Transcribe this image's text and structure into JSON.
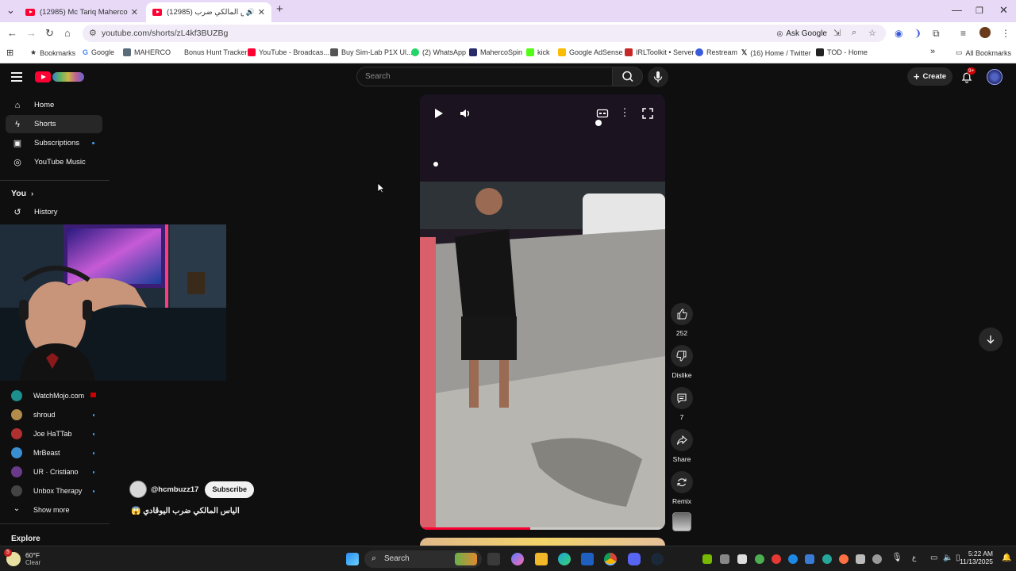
{
  "browser": {
    "tabs": [
      {
        "title": "(12985) Mc Tariq Maherco Drin…",
        "active": false
      },
      {
        "title": "(12985) الياس المالكي ضرب",
        "active": true
      }
    ],
    "new_tab": "+",
    "url": "youtube.com/shorts/zL4kf3BUZBg",
    "ask_google": "Ask Google",
    "bookmarks": [
      {
        "label": "Bookmarks",
        "color": "#333333"
      },
      {
        "label": "Google",
        "color": "#4285f4"
      },
      {
        "label": "MAHERCO",
        "color": "#5b6b7a"
      },
      {
        "label": "Bonus Hunt Tracker",
        "color": "#ffffff"
      },
      {
        "label": "YouTube - Broadcas...",
        "color": "#ff0033"
      },
      {
        "label": "Buy Sim-Lab P1X Ul...",
        "color": "#555555"
      },
      {
        "label": "(2) WhatsApp",
        "color": "#25d366"
      },
      {
        "label": "MahercoSpin",
        "color": "#2a2a6a"
      },
      {
        "label": "kick",
        "color": "#53fc18"
      },
      {
        "label": "Google AdSense",
        "color": "#fbbc04"
      },
      {
        "label": "IRLToolkit • Server",
        "color": "#c62828"
      },
      {
        "label": "Restream",
        "color": "#3a5bd9"
      },
      {
        "label": "(16) Home / Twitter",
        "color": "#111111"
      },
      {
        "label": "TOD - Home",
        "color": "#222222"
      }
    ],
    "all_bookmarks": "All Bookmarks"
  },
  "youtube": {
    "search_placeholder": "Search",
    "create_label": "Create",
    "notif_badge": "9+",
    "sidebar": {
      "main": [
        {
          "label": "Home",
          "icon": "home-icon",
          "active": false
        },
        {
          "label": "Shorts",
          "icon": "shorts-icon",
          "active": true
        },
        {
          "label": "Subscriptions",
          "icon": "subscriptions-icon",
          "active": false
        },
        {
          "label": "YouTube Music",
          "icon": "music-icon",
          "active": false
        }
      ],
      "you_label": "You",
      "history_label": "History",
      "subscriptions": [
        {
          "label": "WatchMojo.com",
          "color": "#1c8f8f"
        },
        {
          "label": "shroud",
          "color": "#b38b4a"
        },
        {
          "label": "Joe HaTTab",
          "color": "#b03030"
        },
        {
          "label": "MrBeast",
          "color": "#3a8fd0"
        },
        {
          "label": "UR · Cristiano",
          "color": "#6a3a8a"
        },
        {
          "label": "Unbox Therapy",
          "color": "#444444"
        }
      ],
      "show_more": "Show more",
      "explore_label": "Explore"
    },
    "short": {
      "channel": "@hcmbuzz17",
      "subscribe_label": "Subscribe",
      "title": "الياس المالكي ضرب اليوڤادي 😱",
      "progress": 0.45,
      "actions": [
        {
          "label": "252",
          "icon": "like-icon"
        },
        {
          "label": "Dislike",
          "icon": "dislike-icon"
        },
        {
          "label": "7",
          "icon": "comment-icon"
        },
        {
          "label": "Share",
          "icon": "share-icon"
        },
        {
          "label": "Remix",
          "icon": "remix-icon"
        }
      ]
    }
  },
  "taskbar": {
    "weather_temp": "60°F",
    "weather_desc": "Clear",
    "weather_badge": "5",
    "search_label": "Search",
    "time": "5:22 AM",
    "date": "11/13/2025",
    "lang": "ع"
  }
}
